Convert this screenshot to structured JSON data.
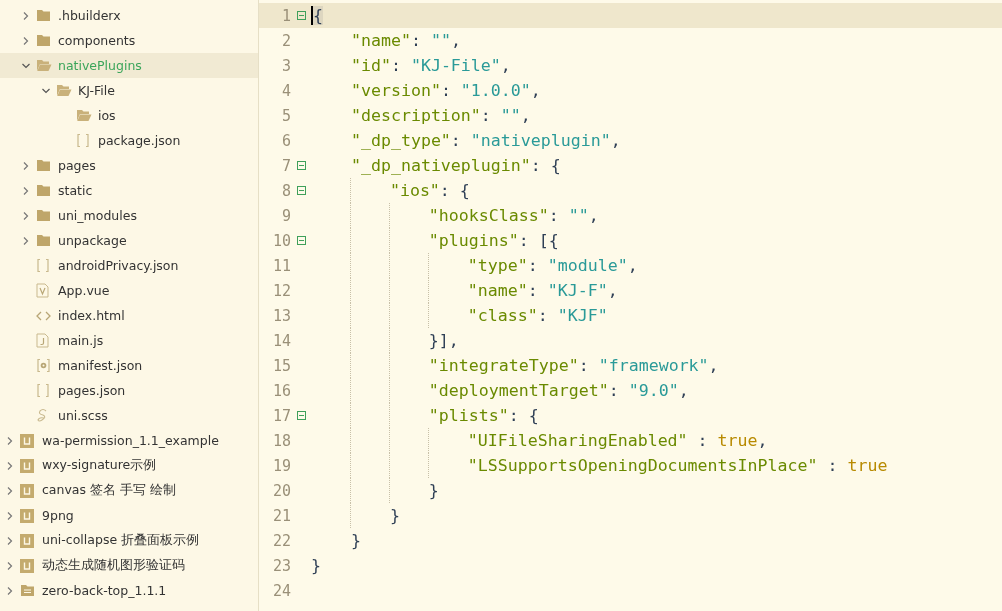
{
  "explorer": {
    "project_files": [
      {
        "name": ".hbuilderx",
        "kind": "folder",
        "expanded": false,
        "selected": false
      },
      {
        "name": "components",
        "kind": "folder",
        "expanded": false,
        "selected": false
      },
      {
        "name": "nativePlugins",
        "kind": "folder",
        "expanded": true,
        "selected": true,
        "children": [
          {
            "name": "KJ-File",
            "kind": "folder",
            "expanded": true,
            "selected": false,
            "children": [
              {
                "name": "ios",
                "kind": "folder",
                "expanded": true,
                "selected": false
              },
              {
                "name": "package.json",
                "kind": "json",
                "selected": false
              }
            ]
          }
        ]
      },
      {
        "name": "pages",
        "kind": "folder",
        "expanded": false,
        "selected": false
      },
      {
        "name": "static",
        "kind": "folder",
        "expanded": false,
        "selected": false
      },
      {
        "name": "uni_modules",
        "kind": "folder",
        "expanded": false,
        "selected": false
      },
      {
        "name": "unpackage",
        "kind": "folder",
        "expanded": false,
        "selected": false
      },
      {
        "name": "androidPrivacy.json",
        "kind": "json",
        "selected": false
      },
      {
        "name": "App.vue",
        "kind": "vue",
        "selected": false
      },
      {
        "name": "index.html",
        "kind": "html",
        "selected": false
      },
      {
        "name": "main.js",
        "kind": "js",
        "selected": false
      },
      {
        "name": "manifest.json",
        "kind": "manifest",
        "selected": false
      },
      {
        "name": "pages.json",
        "kind": "json",
        "selected": false
      },
      {
        "name": "uni.scss",
        "kind": "scss",
        "selected": false
      }
    ],
    "projects": [
      {
        "name": "wa-permission_1.1_example",
        "kind": "uniapp",
        "expanded": false,
        "selected": false
      },
      {
        "name": "wxy-signature示例",
        "kind": "uniapp",
        "expanded": false,
        "selected": false
      },
      {
        "name": "canvas 签名 手写 绘制",
        "kind": "uniapp",
        "expanded": false,
        "selected": false
      },
      {
        "name": "9png",
        "kind": "uniapp",
        "expanded": false,
        "selected": false
      },
      {
        "name": "uni-collapse 折叠面板示例",
        "kind": "uniapp",
        "expanded": false,
        "selected": false
      },
      {
        "name": "动态生成随机图形验证码",
        "kind": "uniapp",
        "expanded": false,
        "selected": false
      },
      {
        "name": "zero-back-top_1.1.1",
        "kind": "plain",
        "expanded": false,
        "selected": false
      }
    ]
  },
  "editor": {
    "lines": [
      {
        "number": "1",
        "foldable": true,
        "current": true,
        "tokens": [
          {
            "kind": "punct",
            "text": "{"
          }
        ],
        "children": [
          {
            "number": "2",
            "foldable": false,
            "current": false,
            "tokens": [
              {
                "kind": "key",
                "text": "\"name\""
              },
              {
                "kind": "punct",
                "text": ": "
              },
              {
                "kind": "string",
                "text": "\"\""
              },
              {
                "kind": "punct",
                "text": ","
              }
            ]
          },
          {
            "number": "3",
            "foldable": false,
            "current": false,
            "tokens": [
              {
                "kind": "key",
                "text": "\"id\""
              },
              {
                "kind": "punct",
                "text": ": "
              },
              {
                "kind": "string",
                "text": "\"KJ-File\""
              },
              {
                "kind": "punct",
                "text": ","
              }
            ]
          },
          {
            "number": "4",
            "foldable": false,
            "current": false,
            "tokens": [
              {
                "kind": "key",
                "text": "\"version\""
              },
              {
                "kind": "punct",
                "text": ": "
              },
              {
                "kind": "string",
                "text": "\"1.0.0\""
              },
              {
                "kind": "punct",
                "text": ","
              }
            ]
          },
          {
            "number": "5",
            "foldable": false,
            "current": false,
            "tokens": [
              {
                "kind": "key",
                "text": "\"description\""
              },
              {
                "kind": "punct",
                "text": ": "
              },
              {
                "kind": "string",
                "text": "\"\""
              },
              {
                "kind": "punct",
                "text": ","
              }
            ]
          },
          {
            "number": "6",
            "foldable": false,
            "current": false,
            "tokens": [
              {
                "kind": "key",
                "text": "\"_dp_type\""
              },
              {
                "kind": "punct",
                "text": ": "
              },
              {
                "kind": "string",
                "text": "\"nativeplugin\""
              },
              {
                "kind": "punct",
                "text": ","
              }
            ]
          },
          {
            "number": "7",
            "foldable": true,
            "current": false,
            "tokens": [
              {
                "kind": "key",
                "text": "\"_dp_nativeplugin\""
              },
              {
                "kind": "punct",
                "text": ": {"
              }
            ],
            "children": [
              {
                "number": "8",
                "foldable": true,
                "current": false,
                "tokens": [
                  {
                    "kind": "key",
                    "text": "\"ios\""
                  },
                  {
                    "kind": "punct",
                    "text": ": {"
                  }
                ],
                "children": [
                  {
                    "number": "9",
                    "foldable": false,
                    "current": false,
                    "tokens": [
                      {
                        "kind": "key",
                        "text": "\"hooksClass\""
                      },
                      {
                        "kind": "punct",
                        "text": ": "
                      },
                      {
                        "kind": "string",
                        "text": "\"\""
                      },
                      {
                        "kind": "punct",
                        "text": ","
                      }
                    ]
                  },
                  {
                    "number": "10",
                    "foldable": true,
                    "current": false,
                    "tokens": [
                      {
                        "kind": "key",
                        "text": "\"plugins\""
                      },
                      {
                        "kind": "punct",
                        "text": ": [{"
                      }
                    ],
                    "children": [
                      {
                        "number": "11",
                        "foldable": false,
                        "current": false,
                        "tokens": [
                          {
                            "kind": "key",
                            "text": "\"type\""
                          },
                          {
                            "kind": "punct",
                            "text": ": "
                          },
                          {
                            "kind": "string",
                            "text": "\"module\""
                          },
                          {
                            "kind": "punct",
                            "text": ","
                          }
                        ]
                      },
                      {
                        "number": "12",
                        "foldable": false,
                        "current": false,
                        "tokens": [
                          {
                            "kind": "key",
                            "text": "\"name\""
                          },
                          {
                            "kind": "punct",
                            "text": ": "
                          },
                          {
                            "kind": "string",
                            "text": "\"KJ-F\""
                          },
                          {
                            "kind": "punct",
                            "text": ","
                          }
                        ]
                      },
                      {
                        "number": "13",
                        "foldable": false,
                        "current": false,
                        "tokens": [
                          {
                            "kind": "key",
                            "text": "\"class\""
                          },
                          {
                            "kind": "punct",
                            "text": ": "
                          },
                          {
                            "kind": "string",
                            "text": "\"KJF\""
                          }
                        ]
                      }
                    ]
                  },
                  {
                    "number": "14",
                    "foldable": false,
                    "current": false,
                    "tokens": [
                      {
                        "kind": "punct",
                        "text": "}],"
                      }
                    ]
                  },
                  {
                    "number": "15",
                    "foldable": false,
                    "current": false,
                    "tokens": [
                      {
                        "kind": "key",
                        "text": "\"integrateType\""
                      },
                      {
                        "kind": "punct",
                        "text": ": "
                      },
                      {
                        "kind": "string",
                        "text": "\"framework\""
                      },
                      {
                        "kind": "punct",
                        "text": ","
                      }
                    ]
                  },
                  {
                    "number": "16",
                    "foldable": false,
                    "current": false,
                    "tokens": [
                      {
                        "kind": "key",
                        "text": "\"deploymentTarget\""
                      },
                      {
                        "kind": "punct",
                        "text": ": "
                      },
                      {
                        "kind": "string",
                        "text": "\"9.0\""
                      },
                      {
                        "kind": "punct",
                        "text": ","
                      }
                    ]
                  },
                  {
                    "number": "17",
                    "foldable": true,
                    "current": false,
                    "tokens": [
                      {
                        "kind": "key",
                        "text": "\"plists\""
                      },
                      {
                        "kind": "punct",
                        "text": ": {"
                      }
                    ],
                    "children": [
                      {
                        "number": "18",
                        "foldable": false,
                        "current": false,
                        "tokens": [
                          {
                            "kind": "key",
                            "text": "\"UIFileSharingEnabled\""
                          },
                          {
                            "kind": "punct",
                            "text": " : "
                          },
                          {
                            "kind": "bool",
                            "text": "true"
                          },
                          {
                            "kind": "punct",
                            "text": ","
                          }
                        ]
                      },
                      {
                        "number": "19",
                        "foldable": false,
                        "current": false,
                        "tokens": [
                          {
                            "kind": "key",
                            "text": "\"LSSupportsOpeningDocumentsInPlace\""
                          },
                          {
                            "kind": "punct",
                            "text": " : "
                          },
                          {
                            "kind": "bool",
                            "text": "true"
                          }
                        ]
                      }
                    ]
                  },
                  {
                    "number": "20",
                    "foldable": false,
                    "current": false,
                    "tokens": [
                      {
                        "kind": "punct",
                        "text": "}"
                      }
                    ]
                  }
                ]
              },
              {
                "number": "21",
                "foldable": false,
                "current": false,
                "tokens": [
                  {
                    "kind": "punct",
                    "text": "}"
                  }
                ]
              }
            ]
          },
          {
            "number": "22",
            "foldable": false,
            "current": false,
            "tokens": [
              {
                "kind": "punct",
                "text": "}"
              }
            ]
          }
        ]
      },
      {
        "number": "23",
        "foldable": false,
        "current": false,
        "tokens": [
          {
            "kind": "punct",
            "text": "}"
          }
        ]
      },
      {
        "number": "24",
        "foldable": false,
        "current": false
      }
    ]
  }
}
